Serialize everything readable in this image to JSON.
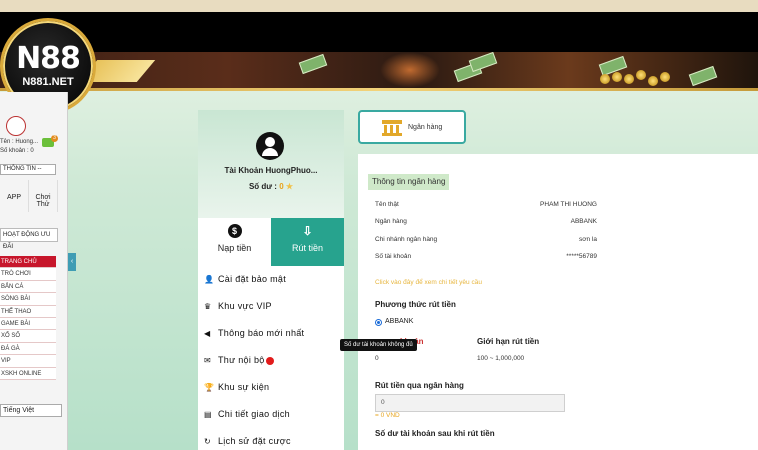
{
  "brand": {
    "logo_main": "N88",
    "logo_sub": "N881.NET"
  },
  "left_nav": {
    "account_name": "Tên : Huong...",
    "account_balance": "Số khoản : 0",
    "notification_count": "3",
    "info_select": "THÔNG TIN --",
    "app_label": "APP",
    "play_free_label": "Chơi Thử",
    "promo_label": "HOẠT ĐỘNG ƯU ĐÃI",
    "items": [
      "TRANG CHỦ",
      "TRÒ CHƠI",
      "BẮN CÁ",
      "SÒNG BÀI",
      "THỂ THAO",
      "GAME BÀI",
      "XỔ SỐ",
      "ĐÁ GÀ",
      "VIP",
      "XSKH ONLINE"
    ],
    "language": "Tiếng Việt"
  },
  "profile": {
    "name": "Tài Khoản HuongPhuo...",
    "balance_label": "Số dư :",
    "balance_value": "0"
  },
  "tabs": {
    "deposit": "Nạp tiền",
    "withdraw": "Rút tiền"
  },
  "menu": [
    {
      "label": "Cài đặt bảo mật",
      "icon": "user-lock-icon"
    },
    {
      "label": "Khu vực VIP",
      "icon": "crown-icon"
    },
    {
      "label": "Thông báo mới nhất",
      "icon": "megaphone-icon"
    },
    {
      "label": "Thư nội bộ",
      "icon": "envelope-icon"
    },
    {
      "label": "Khu sự kiện",
      "icon": "trophy-icon"
    },
    {
      "label": "Chi tiết giao dịch",
      "icon": "receipt-icon"
    },
    {
      "label": "Lịch sử đặt cược",
      "icon": "history-icon"
    }
  ],
  "tooltip": "Số dư tài khoản không đủ",
  "bank_button": "Ngân hàng",
  "bank_info": {
    "section_title": "Thông tin ngân hàng",
    "rows": [
      {
        "label": "Tên thật",
        "value": "PHAM THI HUONG"
      },
      {
        "label": "Ngân hàng",
        "value": "ABBANK"
      },
      {
        "label": "Chi nhánh ngân hàng",
        "value": "sơn la"
      },
      {
        "label": "Số tài khoản",
        "value": "*****56789"
      }
    ],
    "note": "Click vào đây để xem chi tiết yêu cầu"
  },
  "withdraw_method": {
    "title": "Phương thức rút tiền",
    "option": "ABBANK",
    "balance_col_label": "khoản",
    "balance_value": "0",
    "limit_col_label": "Giới hạn rút tiền",
    "limit_value": "100 ~ 1,000,000"
  },
  "withdraw_bank": {
    "title": "Rút tiền qua ngân hàng",
    "amount": "0",
    "converted": "= 0 VND",
    "after_title": "Số dư tài khoản sau khi rút tiền"
  }
}
